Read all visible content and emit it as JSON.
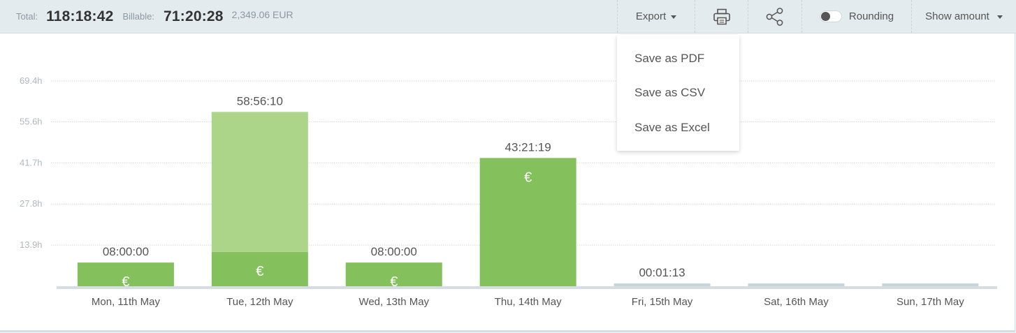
{
  "summary": {
    "total_label": "Total:",
    "total_value": "118:18:42",
    "billable_label": "Billable:",
    "billable_value": "71:20:28",
    "amount": "2,349.06 EUR"
  },
  "toolbar": {
    "export_label": "Export",
    "print_icon": "printer-icon",
    "share_icon": "share-icon",
    "rounding_label": "Rounding",
    "rounding_on": false,
    "show_amount_label": "Show amount"
  },
  "export_menu": [
    {
      "label": "Save as PDF"
    },
    {
      "label": "Save as CSV"
    },
    {
      "label": "Save as Excel"
    }
  ],
  "colors": {
    "billable": "#84c15d",
    "non_billable": "#acd589",
    "empty_bar": "#c9d6d9",
    "axis": "#d3dde2",
    "grid": "#d9d9d9"
  },
  "chart_data": {
    "type": "bar",
    "stacked": true,
    "categories": [
      "Mon, 11th May",
      "Tue, 12th May",
      "Wed, 13th May",
      "Thu, 14th May",
      "Fri, 15th May",
      "Sat, 16th May",
      "Sun, 17th May"
    ],
    "bar_labels": [
      "08:00:00",
      "58:56:10",
      "08:00:00",
      "43:21:19",
      "00:01:13",
      "",
      ""
    ],
    "series": [
      {
        "values": [
          8.0,
          11.6,
          8.0,
          43.36,
          0.0,
          0,
          0
        ],
        "marker": "€"
      },
      {
        "values": [
          0.0,
          47.34,
          0.0,
          0.0,
          0.02,
          0,
          0
        ]
      }
    ],
    "yticks": [
      13.9,
      27.8,
      41.7,
      55.6,
      69.4
    ],
    "ytick_labels": [
      "13.9h",
      "27.8h",
      "41.7h",
      "55.6h",
      "69.4h"
    ],
    "ylim": [
      0,
      69.4
    ],
    "grid": true
  }
}
